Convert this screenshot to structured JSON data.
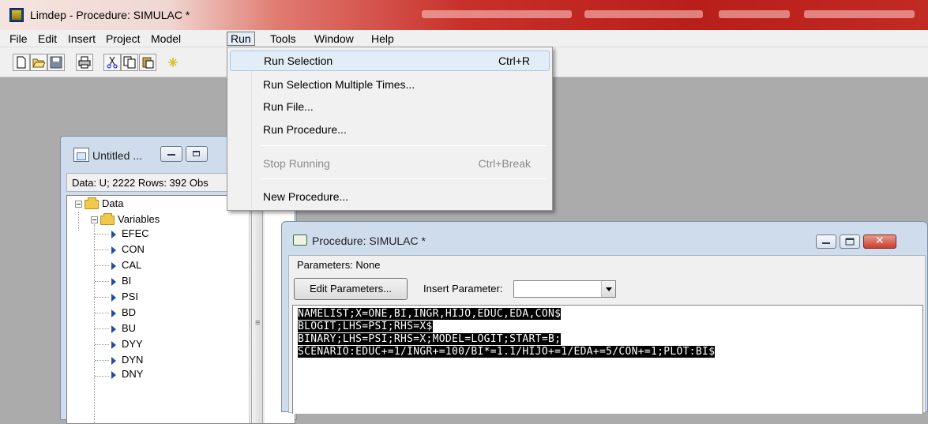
{
  "window": {
    "title": "Limdep - Procedure: SIMULAC *"
  },
  "menubar": {
    "items": [
      "File",
      "Edit",
      "Insert",
      "Project",
      "Model",
      "Run",
      "Tools",
      "Window",
      "Help"
    ]
  },
  "run_menu": {
    "items": [
      {
        "label": "Run Selection",
        "shortcut": "Ctrl+R",
        "enabled": true,
        "highlighted": true
      },
      {
        "label": "Run Selection Multiple Times...",
        "shortcut": "",
        "enabled": true
      },
      {
        "label": "Run File...",
        "shortcut": "",
        "enabled": true
      },
      {
        "label": "Run Procedure...",
        "shortcut": "",
        "enabled": true
      },
      {
        "label": "Stop Running",
        "shortcut": "Ctrl+Break",
        "enabled": false
      },
      {
        "label": "New Procedure...",
        "shortcut": "",
        "enabled": true
      }
    ]
  },
  "untitled_window": {
    "title": "Untitled ...",
    "data_info": "Data: U; 2222 Rows: 392 Obs",
    "tree": {
      "root": "Data",
      "folder": "Variables",
      "variables": [
        "EFEC",
        "CON",
        "CAL",
        "BI",
        "PSI",
        "BD",
        "BU",
        "DYY",
        "DYN",
        "DNY"
      ]
    }
  },
  "procedure_window": {
    "title": "Procedure: SIMULAC *",
    "parameters_label": "Parameters: None",
    "edit_parameters_label": "Edit Parameters...",
    "insert_parameter_label": "Insert Parameter:",
    "insert_parameter_value": "",
    "code_lines": [
      "NAMELIST;X=ONE,BI,INGR,HIJO,EDUC,EDA,CON$",
      "BLOGIT;LHS=PSI;RHS=X$",
      "BINARY;LHS=PSI;RHS=X;MODEL=LOGIT;START=B;",
      "SCENARIO:EDUC+=1/INGR+=100/BI*=1.1/HIJO+=1/EDA+=5/CON+=1;PLOT:BI$"
    ]
  },
  "colors": {
    "title_gradient_end": "#b81e1a",
    "menu_highlight": "#e3edf8",
    "code_bg": "#000000",
    "code_fg": "#ffffff"
  },
  "icons": [
    "app-icon",
    "new-file-icon",
    "open-folder-icon",
    "save-icon",
    "print-icon",
    "cut-icon",
    "copy-icon",
    "paste-icon",
    "wizard-icon",
    "folder-icon",
    "variable-arrow-icon",
    "procedure-icon"
  ]
}
